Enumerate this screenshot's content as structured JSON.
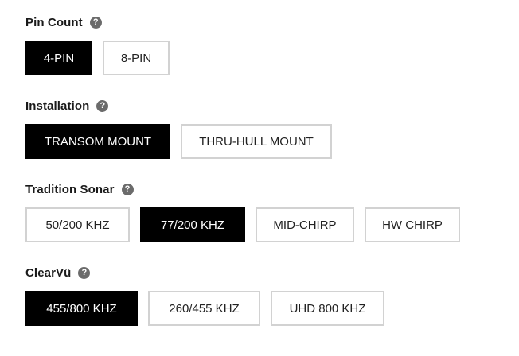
{
  "help_glyph": "?",
  "groups": {
    "pin_count": {
      "title": "Pin Count",
      "selected": "4-PIN",
      "options": [
        "4-PIN",
        "8-PIN"
      ]
    },
    "installation": {
      "title": "Installation",
      "selected": "TRANSOM MOUNT",
      "options": [
        "TRANSOM MOUNT",
        "THRU-HULL MOUNT"
      ]
    },
    "tradition_sonar": {
      "title": "Tradition Sonar",
      "selected": "77/200 KHZ",
      "options": [
        "50/200 KHZ",
        "77/200 KHZ",
        "MID-CHIRP",
        "HW CHIRP"
      ]
    },
    "clearvu": {
      "title": "ClearVü",
      "selected": "455/800 KHZ",
      "options": [
        "455/800 KHZ",
        "260/455 KHZ",
        "UHD 800 KHZ"
      ]
    }
  },
  "colors": {
    "selected_bg": "#000000",
    "selected_text": "#ffffff",
    "unselected_border": "#d2d2d2",
    "help_icon_bg": "#6b6b6b"
  }
}
